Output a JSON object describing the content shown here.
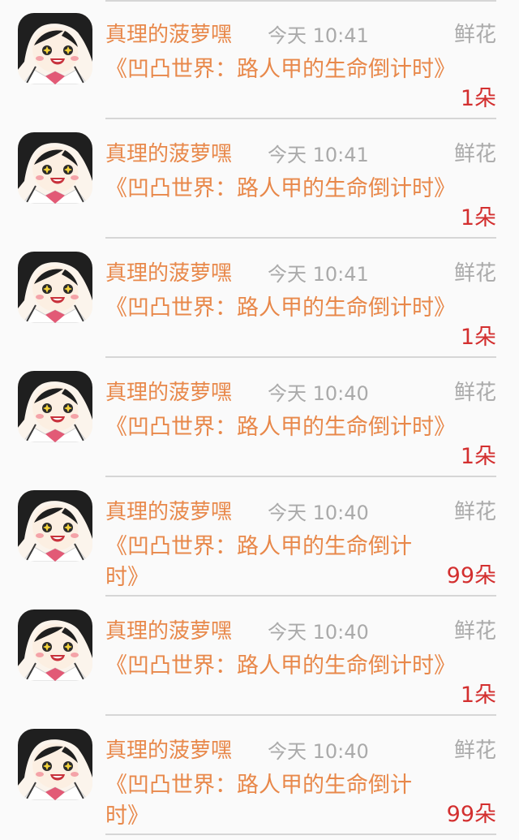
{
  "items": [
    {
      "name": "真理的菠萝嘿",
      "time": "今天 10:41",
      "gift_type": "鲜花",
      "book": "《凹凸世界：路人甲的生命倒计时》",
      "count": "1朵"
    },
    {
      "name": "真理的菠萝嘿",
      "time": "今天 10:41",
      "gift_type": "鲜花",
      "book": "《凹凸世界：路人甲的生命倒计时》",
      "count": "1朵"
    },
    {
      "name": "真理的菠萝嘿",
      "time": "今天 10:41",
      "gift_type": "鲜花",
      "book": "《凹凸世界：路人甲的生命倒计时》",
      "count": "1朵"
    },
    {
      "name": "真理的菠萝嘿",
      "time": "今天 10:40",
      "gift_type": "鲜花",
      "book": "《凹凸世界：路人甲的生命倒计时》",
      "count": "1朵"
    },
    {
      "name": "真理的菠萝嘿",
      "time": "今天 10:40",
      "gift_type": "鲜花",
      "book": "《凹凸世界：路人甲的生命倒计时》",
      "count": "99朵"
    },
    {
      "name": "真理的菠萝嘿",
      "time": "今天 10:40",
      "gift_type": "鲜花",
      "book": "《凹凸世界：路人甲的生命倒计时》",
      "count": "1朵"
    },
    {
      "name": "真理的菠萝嘿",
      "time": "今天 10:40",
      "gift_type": "鲜花",
      "book": "《凹凸世界：路人甲的生命倒计时》",
      "count": "99朵"
    }
  ]
}
